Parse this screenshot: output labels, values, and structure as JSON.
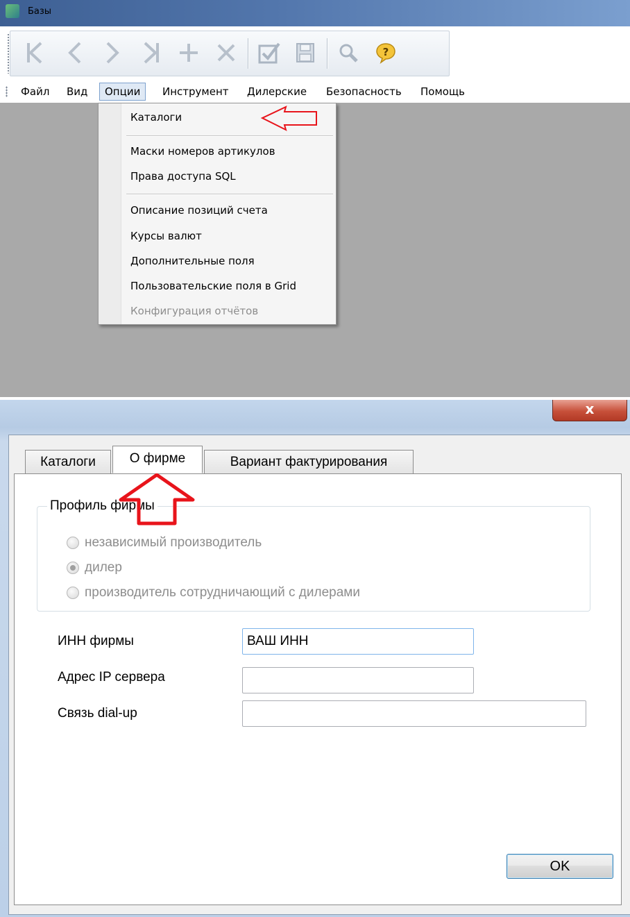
{
  "window": {
    "title": "Базы"
  },
  "toolbar": {
    "buttons": [
      {
        "name": "first-record-icon",
        "glyph": "K"
      },
      {
        "name": "prev-record-icon",
        "glyph": "‹"
      },
      {
        "name": "next-record-icon",
        "glyph": "›"
      },
      {
        "name": "last-record-icon",
        "glyph": "›|"
      },
      {
        "name": "add-record-icon",
        "glyph": "+"
      },
      {
        "name": "delete-record-icon",
        "glyph": "×"
      },
      {
        "name": "confirm-checkbox-icon",
        "glyph": "☑"
      },
      {
        "name": "save-floppy-icon",
        "glyph": "▣"
      },
      {
        "name": "search-magnifier-icon",
        "glyph": "⚲"
      },
      {
        "name": "help-bubble-icon",
        "glyph": "?"
      }
    ]
  },
  "menubar": {
    "items": [
      "Файл",
      "Вид",
      "Опции",
      "Инструмент",
      "Дилерские",
      "Безопасность",
      "Помощь"
    ],
    "active_index": 2
  },
  "options_menu": {
    "items": [
      {
        "label": "Каталоги",
        "enabled": true
      },
      {
        "label": "Маски номеров артикулов",
        "enabled": true
      },
      {
        "label": "Права доступа SQL",
        "enabled": true
      },
      {
        "label": "Описание позиций счета",
        "enabled": true
      },
      {
        "label": "Курсы валют",
        "enabled": true
      },
      {
        "label": "Дополнительные поля",
        "enabled": true
      },
      {
        "label": "Пользовательские поля в Grid",
        "enabled": true
      },
      {
        "label": "Конфигурация отчётов",
        "enabled": false
      }
    ]
  },
  "dialog": {
    "close_label": "x",
    "tabs": [
      "Каталоги",
      "О фирме",
      "Вариант фактурирования"
    ],
    "selected_tab": 1,
    "profile_group": {
      "legend": "Профиль фирмы",
      "options": [
        "независимый производитель",
        "дилер",
        "производитель сотрудничающий с дилерами"
      ],
      "selected": 1,
      "enabled": false
    },
    "fields": {
      "inn_label": "ИНН фирмы",
      "inn_value": "ВАШ ИНН",
      "ip_label": "Адрес IP сервера",
      "ip_value": "",
      "dialup_label": "Связь dial-up",
      "dialup_value": ""
    },
    "ok_label": "OK"
  },
  "annotation_colors": {
    "arrow": "#e8141b"
  }
}
